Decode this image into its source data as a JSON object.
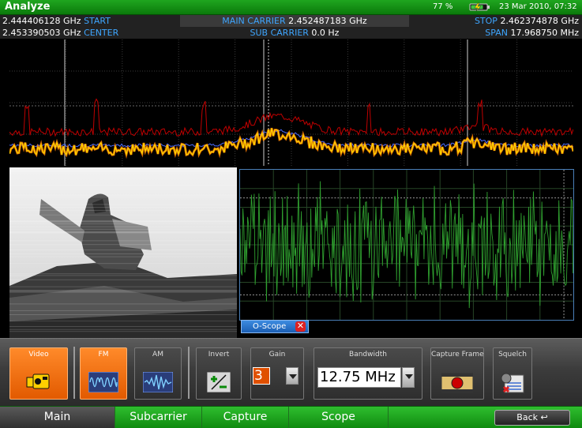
{
  "titlebar": {
    "title": "Analyze",
    "battery": "77 %",
    "datetime": "23 Mar 2010, 07:32"
  },
  "freq": {
    "start_value": "2.444406128 GHz",
    "start_label": "START",
    "main_carrier_label": "MAIN CARRIER",
    "main_carrier_value": "2.452487183 GHz",
    "stop_label": "STOP",
    "stop_value": "2.462374878 GHz",
    "center_value": "2.453390503 GHz",
    "center_label": "CENTER",
    "sub_carrier_label": "SUB CARRIER",
    "sub_carrier_value": "0.0 Hz",
    "span_label": "SPAN",
    "span_value": "17.968750 MHz"
  },
  "oscope": {
    "tab_label": "O-Scope"
  },
  "toolbar": {
    "video_label": "Video",
    "fm_label": "FM",
    "am_label": "AM",
    "invert_label": "Invert",
    "gain_label": "Gain",
    "gain_value": "3",
    "bandwidth_label": "Bandwidth",
    "bandwidth_value": "12.75 MHz",
    "capture_frame_label": "Capture Frame",
    "squelch_label": "Squelch"
  },
  "tabs": {
    "main": "Main",
    "subcarrier": "Subcarrier",
    "capture": "Capture",
    "scope": "Scope",
    "back": "Back ↩"
  },
  "colors": {
    "titlebar": "#1fa51f",
    "accent_blue": "#3ea6ff",
    "active_orange": "#ff8a2a",
    "trace_yellow": "#ffd400",
    "trace_red": "#c00000",
    "trace_blue": "#4a6cff",
    "scope_green": "#2fa02f"
  }
}
